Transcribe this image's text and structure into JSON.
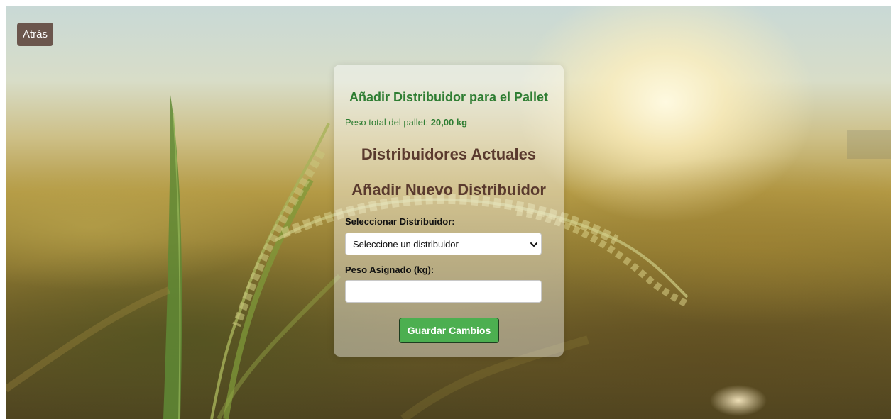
{
  "nav": {
    "back_label": "Atrás"
  },
  "form": {
    "title": "Añadir Distribuidor para el Pallet",
    "weight_prefix": "Peso total del pallet: ",
    "weight_value": "20,00 kg",
    "current_heading": "Distribuidores Actuales",
    "new_heading": "Añadir Nuevo Distribuidor",
    "distributor_label": "Seleccionar Distribuidor:",
    "distributor_selected": "Seleccione un distribuidor",
    "weight_label": "Peso Asignado (kg):",
    "weight_input_value": "",
    "save_label": "Guardar Cambios"
  },
  "colors": {
    "title_green": "#2e7d32",
    "heading_brown": "#5a3a2e",
    "back_button": "#6b564d",
    "save_button": "#4caf50"
  },
  "icons": {
    "select_indicator": "chevron-down-icon"
  }
}
